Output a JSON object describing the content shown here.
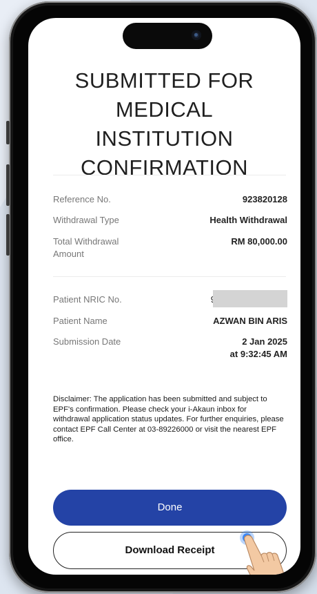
{
  "title_lines": [
    "SUBMITTED FOR",
    "MEDICAL",
    "INSTITUTION",
    "CONFIRMATION"
  ],
  "details": {
    "reference_label": "Reference No.",
    "reference_value": "923820128",
    "withdrawal_type_label": "Withdrawal Type",
    "withdrawal_type_value": "Health Withdrawal",
    "total_amount_label": "Total Withdrawal Amount",
    "total_amount_value": "RM 80,000.00"
  },
  "patient": {
    "nric_label": "Patient NRIC No.",
    "nric_visible_prefix": "9",
    "name_label": "Patient Name",
    "name_value": "AZWAN BIN ARIS",
    "submission_label": "Submission Date",
    "submission_date": "2 Jan 2025",
    "submission_time": "at 9:32:45 AM"
  },
  "disclaimer": "Disclaimer: The application has been submitted and subject to EPF's confirmation. Please check your i-Akaun inbox for withdrawal application status updates. For further enquiries, please contact EPF Call Center at 03-89226000 or visit the nearest EPF office.",
  "buttons": {
    "done": "Done",
    "download_receipt": "Download Receipt"
  },
  "colors": {
    "primary": "#2443a6",
    "label_gray": "#777777",
    "background": "#dde5f0"
  },
  "icons": [
    "camera-icon",
    "tap-indicator-icon",
    "pointing-hand-icon"
  ]
}
